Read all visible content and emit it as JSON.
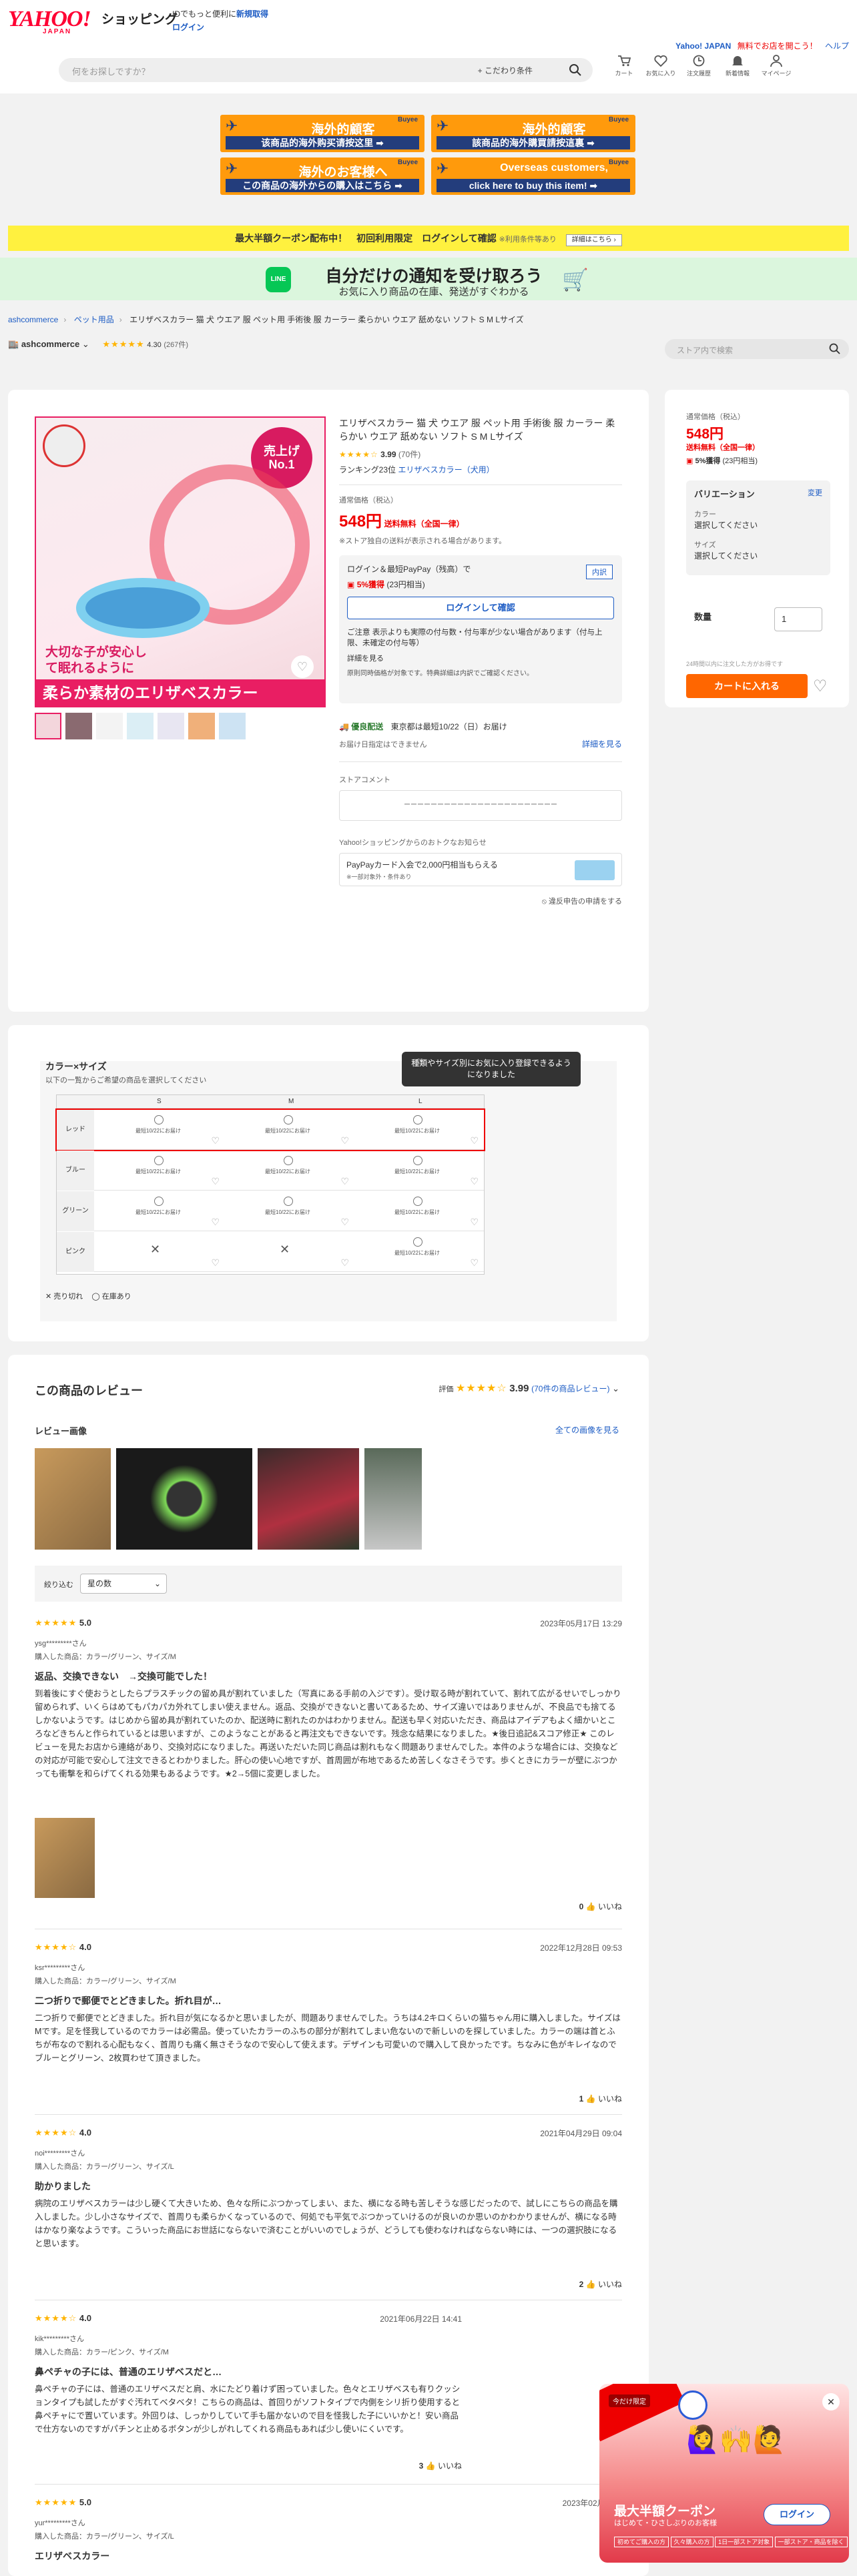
{
  "header": {
    "logo": "YAHOO!",
    "logo_sub": "JAPAN",
    "shop": "ショッピング",
    "note1": "IDでもっと便利に",
    "note1_link": "新規取得",
    "login": "ログイン",
    "top_right": "Yahoo! JAPAN",
    "top_right2": "無料でお店を開こう！",
    "help": "ヘルプ",
    "search_placeholder": "何をお探しですか？",
    "search_cond": "+ こだわり条件",
    "nav": [
      "カート",
      "お気に入り",
      "注文履歴",
      "新着情報",
      "マイページ"
    ]
  },
  "banners": [
    {
      "row1": "海外的顧客",
      "row2": "该商品的海外购买请按这里 ➡",
      "by": "Buyee"
    },
    {
      "row1": "海外的顧客",
      "row2": "該商品的海外購買請按這裏 ➡",
      "by": "Buyee"
    },
    {
      "row1": "海外のお客様へ",
      "row2": "この商品の海外からの購入はこちら ➡",
      "by": "Buyee"
    },
    {
      "row1": "Overseas customers,",
      "row2": "click here to buy this item! ➡",
      "by": "Buyee"
    }
  ],
  "coupon_bar": {
    "text": "最大半額クーポン配布中！　初回利用限定　ログインして確認",
    "sub": "※利用条件等あり",
    "btn": "詳細はこちら ›"
  },
  "line_bar": {
    "title": "自分だけの通知を受け取ろう",
    "sub": "お気に入り商品の在庫、発送がすぐわかる"
  },
  "breadcrumb": [
    "ashcommerce",
    "ペット用品",
    "エリザベスカラー 猫 犬 ウエア 服 ペット用 手術後 服 カーラー 柔らかい ウエア 舐めない ソフト S M Lサイズ"
  ],
  "store": {
    "name": "ashcommerce",
    "rating": "4.30",
    "count": "(267件)",
    "search_placeholder": "ストア内で検索"
  },
  "product": {
    "title": "エリザベスカラー 猫 犬 ウエア 服 ペット用 手術後 服 カーラー 柔らかい ウエア 舐めない ソフト S M Lサイズ",
    "rating": "3.99",
    "rating_count": "(70件)",
    "ranking": "ランキング23位",
    "ranking_cat": "エリザベスカラー（犬用）",
    "price_label": "通常価格（税込）",
    "price": "548円",
    "shipping": "送料無料（全国一律）",
    "shipping_note": "※ストア独自の送料が表示される場合があります。",
    "paypay_note": "ログイン＆最短PayPay（残高）で",
    "points": "5%獲得",
    "points_detail": "(23円相当)",
    "detail_btn": "内訳",
    "login_btn": "ログインして確認",
    "caution": "ご注意 表示よりも実際の付与数・付与率が少ない場合があります（付与上限、未確定の付与等）",
    "detail_link": "詳細を見る",
    "caution2": "原則同時価格が対象です。特典詳細は内訳でご確認ください。",
    "delivery_badge": "優良配送",
    "delivery": "東京都は最短10/22（日）お届け",
    "delivery_note": "お届け日指定はできません",
    "delivery_more": "詳細を見る",
    "store_comment": "ストアコメント",
    "store_comment_text": "ーーーーーーーーーーーーーーーーーーーーーーー",
    "deal_label": "Yahoo!ショッピングからのおトクなお知らせ",
    "deal_text": "PayPayカード入会で2,000円相当もらえる",
    "deal_sub": "※一部対象外・条件あり",
    "report": "違反申告の申請をする",
    "promo_badge": "売上げ No.1",
    "img_caption": "柔らか素材のエリザベスカラー",
    "img_caption2": "大切な子が安心して眠れるように"
  },
  "sidebar": {
    "price_label": "通常価格（税込）",
    "price": "548円",
    "shipping": "送料無料（全国一律）",
    "points": "5%獲得",
    "points_detail": "(23円相当)",
    "variation": "バリエーション",
    "change": "変更",
    "color_label": "カラー",
    "color_val": "選択してください",
    "size_label": "サイズ",
    "size_val": "選択してください",
    "qty_label": "数量",
    "qty": "1",
    "stock_note": "24時間以内に注文した方がお得です",
    "cart": "カートに入れる"
  },
  "variations": {
    "title": "カラー×サイズ",
    "sub": "以下の一覧からご希望の商品を選択してください",
    "tooltip": "種類やサイズ別にお気に入り登録できるようになりました",
    "sizes": [
      "S",
      "M",
      "L"
    ],
    "colors": [
      "レッド",
      "ブルー",
      "グリーン",
      "ピンク"
    ],
    "cell_note": "最短10/22にお届け",
    "legend_soldout": "売り切れ",
    "legend_stock": "在庫あり"
  },
  "reviews": {
    "title": "この商品のレビュー",
    "label": "評価",
    "rating": "3.99",
    "count": "(70件の商品レビュー)",
    "images_label": "レビュー画像",
    "all_images": "全ての画像を見る",
    "sort_label": "絞り込む",
    "sort_val": "星の数",
    "items": [
      {
        "stars": "5.0",
        "date": "2023年05月17日 13:29",
        "who": "ysg*********さん",
        "buy": "購入した商品：カラー/グリーン、サイズ/M",
        "title": "返品、交換できない　→交換可能でした！",
        "body": "到着後にすぐ使おうとしたらプラスチックの留め具が割れていました（写真にある手前の入ジです）。受け取る時が割れていて、割れて広がるせいでしっかり留められず、いくらはめてもパカパカ外れてしまい使えません。返品、交換ができないと書いてあるため、サイズ違いではありませんが、不良品でも捨てるしかないようです。はじめから留め具が割れていたのか、配送時に割れたのかはわかりません。配送も早く対応いただき、商品はアイデアもよく細かいところなどきちんと作られているとは思いますが、このようなことがあると再注文もできないです。残念な結果になりました。★後日追記&スコア修正★ このレビューを見たお店から連絡があり、交換対応になりました。再送いただいた同じ商品は割れもなく問題ありませんでした。本件のような場合には、交換などの対応が可能で安心して注文できるとわかりました。肝心の使い心地ですが、首周囲が布地であるため苦しくなさそうです。歩くときにカラーが壁にぶつかっても衝撃を和らげてくれる効果もあるようです。★2→5個に変更しました。",
        "like": "0",
        "like_label": "いいね"
      },
      {
        "stars": "4.0",
        "date": "2022年12月28日 09:53",
        "who": "ksr*********さん",
        "buy": "購入した商品：カラー/グリーン、サイズ/M",
        "title": "二つ折りで郵便でとどきました。折れ目が…",
        "body": "二つ折りで郵便でとどきました。折れ目が気になるかと思いましたが、問題ありませんでした。うちは4.2キロくらいの猫ちゃん用に購入しました。サイズはMです。足を怪我しているのでカラーは必需品。使っていたカラーのふちの部分が割れてしまい危ないので新しいのを探していました。カラーの端は首とふちが布なので割れる心配もなく、首周りも痛く無さそうなので安心して使えます。デザインも可愛いので購入して良かったです。ちなみに色がキレイなのでブルーとグリーン、2枚買わせて頂きました。",
        "like": "1",
        "like_label": "いいね"
      },
      {
        "stars": "4.0",
        "date": "2021年04月29日 09:04",
        "who": "noi*********さん",
        "buy": "購入した商品：カラー/グリーン、サイズ/L",
        "title": "助かりました",
        "body": "病院のエリザベスカラーは少し硬くて大きいため、色々な所にぶつかってしまい、また、横になる時も苦しそうな感じだったので、試しにこちらの商品を購入しました。少し小さなサイズで、首周りも柔らかくなっているので、何処でも平気でぶつかっていけるのが良いのか思いのかわかりませんが、横になる時はかなり楽なようです。こういった商品にお世話にならないで済むことがいいのでしょうが、どうしても使わなければならない時には、一つの選択肢になると思います。",
        "like": "2",
        "like_label": "いいね"
      },
      {
        "stars": "4.0",
        "date": "2021年06月22日 14:41",
        "who": "kik*********さん",
        "buy": "購入した商品：カラー/ピンク、サイズ/M",
        "title": "鼻ペチャの子には、普通のエリザベスだと…",
        "body": "鼻ペチャの子には、普通のエリザベスだと肩、水にたどり着けず困っていました。色々とエリザベスも有りクッションタイプも試したがすぐ汚れてベタベタ！こちらの商品は、首回りがソフトタイプで内側をシリ折り使用すると鼻ペチャにで置いています。外回りは、しっかりしていて手も届かないので目を怪我した子にいいかと！安い商品で仕方ないのですがパチンと止めるボタンが少しがれしてくれる商品もあれば少し使いにくいです。",
        "like": "3",
        "like_label": "いいね"
      },
      {
        "stars": "5.0",
        "date": "2023年02月16日",
        "who": "yur*********さん",
        "buy": "購入した商品：カラー/グリーン、サイズ/L",
        "title": "エリザベスカラー",
        "body": "",
        "like": "",
        "like_label": ""
      }
    ]
  },
  "popup": {
    "tag": "今だけ限定",
    "title": "最大半額クーポン",
    "sub": "はじめて・ひさしぶりのお客様",
    "btn": "ログイン",
    "tags": [
      "初めてご購入の方",
      "久々購入の方",
      "1日一部ストア対象",
      "一部ストア・商品を除く"
    ]
  }
}
